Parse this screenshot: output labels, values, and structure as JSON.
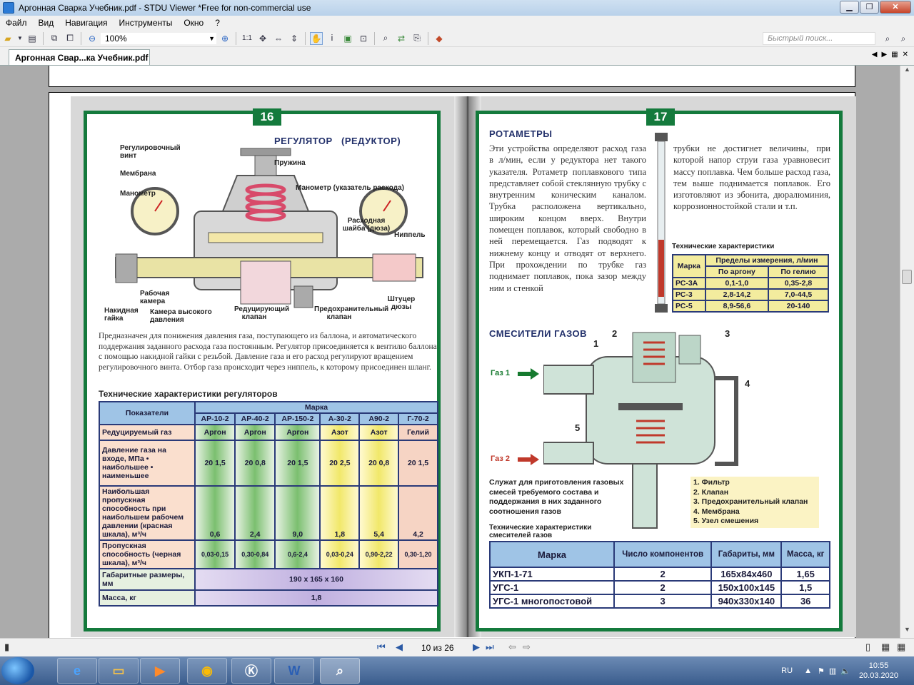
{
  "window": {
    "title": "Аргонная Сварка Учебник.pdf - STDU Viewer *Free for non-commercial use"
  },
  "menu": [
    "Файл",
    "Вид",
    "Навигация",
    "Инструменты",
    "Окно",
    "?"
  ],
  "toolbar": {
    "zoom": "100%",
    "ratio": "1:1",
    "search_placeholder": "Быстрый поиск..."
  },
  "tab": {
    "label": "Аргонная Свар...ка Учебник.pdf"
  },
  "left_page": {
    "number": "16",
    "title": "РЕГУЛЯТОР   (РЕДУКТОР)",
    "labels": [
      "Регулировочный винт",
      "Пружина",
      "Мембрана",
      "Манометр",
      "Манометр (указатель расхода)",
      "Расходная шайба (дюза)",
      "Ниппель",
      "Рабочая камера",
      "Накидная гайка",
      "Камера высокого давления",
      "Редуцирующий клапан",
      "Предохранительный клапан",
      "Штуцер дюзы"
    ],
    "description": "Предназначен для понижения давления газа, поступающего из баллона, и автоматического поддержания заданного расхода газа постоянным. Регулятор присоединяется к вентилю баллона с помощью накидной гайки с резьбой. Давление газа и его расход регулируют вращением регулировочного винта. Отбор газа происходит через ниппель, к которому присоединен шланг.",
    "table_title": "Технические характеристики регуляторов",
    "table": {
      "h_params": "Показатели",
      "h_brand": "Марка",
      "models": [
        "АР-10-2",
        "АР-40-2",
        "АР-150-2",
        "А-30-2",
        "А90-2",
        "Г-70-2"
      ],
      "rows": [
        {
          "label": "Редуцируемый газ",
          "values": [
            "Аргон",
            "Аргон",
            "Аргон",
            "Азот",
            "Азот",
            "Гелий"
          ]
        },
        {
          "label": "Давление газа на входе, МПа • наибольшее • наименьшее",
          "values": [
            "20 1,5",
            "20 0,8",
            "20 1,5",
            "20 2,5",
            "20 0,8",
            "20 1,5"
          ]
        },
        {
          "label": "Наибольшая пропускная способность при наибольшем рабочем давлении (красная шкала), м³/ч",
          "values": [
            "0,6",
            "2,4",
            "9,0",
            "1,8",
            "5,4",
            "4,2"
          ]
        },
        {
          "label": "Пропускная способность (черная шкала), м³/ч",
          "values": [
            "0,03-0,15",
            "0,30-0,84",
            "0,6-2,4",
            "0,03-0,24",
            "0,90-2,22",
            "0,30-1,20"
          ]
        }
      ],
      "dim_label": "Габаритные размеры, мм",
      "dim_value": "190 x 165 x 160",
      "mass_label": "Масса, кг",
      "mass_value": "1,8"
    }
  },
  "right_page": {
    "number": "17",
    "rotameters_title": "РОТАМЕТРЫ",
    "rotameters_text_left": "Эти устройства определяют расход газа в л/мин, если у редуктора нет такого указателя. Ротаметр поплавкового типа представляет собой стеклянную трубку с внутренним коническим каналом. Трубка расположена вертикально, широким концом вверх. Внутри помещен поплавок, который свободно в ней перемещается. Газ подводят к нижнему концу и отводят от верхнего. При прохождении по трубке газ поднимает поплавок, пока зазор между ним и стенкой",
    "rotameters_text_right": "трубки не достигнет величины, при которой напор струи газа уравновесит массу поплавка. Чем больше расход газа, тем выше поднимается поплавок. Его изготовляют из эбонита, дюралюминия, коррозионностойкой стали и т.п.",
    "rot_table_title": "Технические характеристики",
    "rot_table": {
      "h_brand": "Марка",
      "h_limits": "Пределы измерения, л/мин",
      "h_argon": "По аргону",
      "h_helium": "По гелию",
      "rows": [
        {
          "brand": "РС-3А",
          "argon": "0,1-1,0",
          "helium": "0,35-2,8"
        },
        {
          "brand": "РС-3",
          "argon": "2,8-14,2",
          "helium": "7,0-44,5"
        },
        {
          "brand": "РС-5",
          "argon": "8,9-56,6",
          "helium": "20-140"
        }
      ]
    },
    "mixers_title": "СМЕСИТЕЛИ ГАЗОВ",
    "gas1": "Газ 1",
    "gas2": "Газ 2",
    "callouts": [
      "1",
      "2",
      "3",
      "4",
      "5"
    ],
    "mixers_text": "Служат для приготовления газовых смесей требуемого состава и поддержания в них заданного соотношения газов",
    "legend": [
      "1. Фильтр",
      "2. Клапан",
      "3. Предохранительный клапан",
      "4. Мембрана",
      "5. Узел смешения"
    ],
    "mix_table_title": "Технические характеристики смесителей газов",
    "mix_table": {
      "h_brand": "Марка",
      "h_components": "Число компонентов",
      "h_dims": "Габариты, мм",
      "h_mass": "Масса, кг",
      "rows": [
        {
          "brand": "УКП-1-71",
          "components": "2",
          "dims": "165x84x460",
          "mass": "1,65"
        },
        {
          "brand": "УГС-1",
          "components": "2",
          "dims": "150x100x145",
          "mass": "1,5"
        },
        {
          "brand": "УГС-1 многопостовой",
          "components": "3",
          "dims": "940x330x140",
          "mass": "36"
        }
      ]
    }
  },
  "status": {
    "page_indicator": "10 из 26"
  },
  "taskbar": {
    "lang": "RU",
    "time": "10:55",
    "date": "20.03.2020"
  }
}
